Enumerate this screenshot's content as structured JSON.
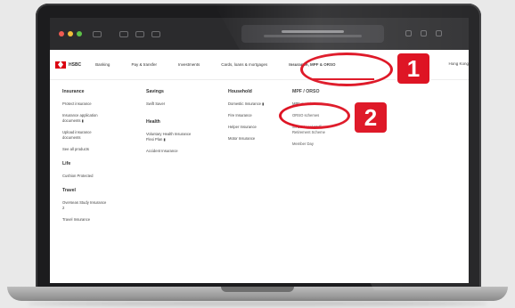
{
  "nav": {
    "logo_text": "HSBC",
    "items": [
      "Banking",
      "Pay & transfer",
      "Investments",
      "Cards, loans & mortgages",
      "Insurance, MPF & ORSO"
    ],
    "tail": "Hong Kong"
  },
  "menu": {
    "col1": {
      "insurance_heading": "Insurance",
      "insurance_links": [
        "Protect insurance",
        "Insurance application\ndocuments  ▮",
        "Upload insurance\ndocuments",
        "See all products"
      ],
      "life_heading": "Life",
      "life_links": [
        "Cushion Protected"
      ],
      "travel_heading": "Travel",
      "travel_links": [
        "Overseas Study Insurance\n2",
        "Travel Insurance"
      ]
    },
    "col2": {
      "savings_heading": "Savings",
      "savings_links": [
        "Swift Saver"
      ],
      "health_heading": "Health",
      "health_links": [
        "Voluntary Health Insurance\nFlexi Plan  ▮",
        "Accident Insurance"
      ]
    },
    "col3": {
      "household_heading": "Household",
      "household_links": [
        "Domestic Insurance  ▮",
        "Fire Insurance",
        "Helper Insurance",
        "Motor Insurance"
      ]
    },
    "col4": {
      "mpf_heading": "MPF / ORSO",
      "mpf_links": [
        "MPF overview",
        "ORSO schemes",
        "SVOE Local Staff\nRetirement Scheme",
        "Member Day"
      ]
    }
  },
  "annotations": {
    "badge1": "1",
    "badge2": "2"
  },
  "colors": {
    "brand_red": "#db0011",
    "annotation_red": "#db0011"
  }
}
